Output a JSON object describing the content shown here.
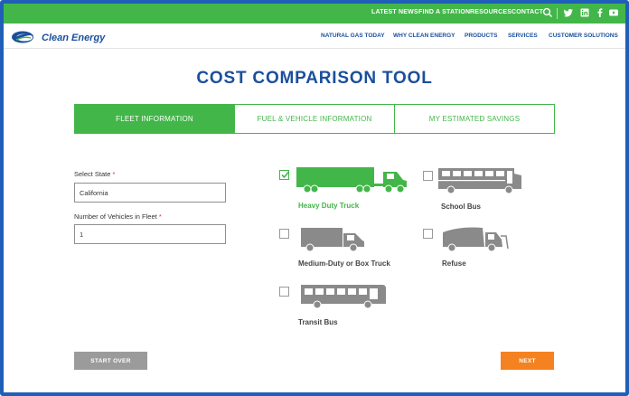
{
  "topbar": {
    "links": [
      "LATEST NEWS",
      "FIND A STATION",
      "RESOURCES",
      "CONTACT"
    ],
    "icons": [
      "search-icon",
      "twitter-icon",
      "linkedin-icon",
      "facebook-icon",
      "youtube-icon"
    ]
  },
  "header": {
    "logo_text": "Clean Energy",
    "nav": [
      "NATURAL GAS TODAY",
      "WHY CLEAN ENERGY",
      "PRODUCTS",
      "SERVICES",
      "CUSTOMER SOLUTIONS"
    ]
  },
  "page": {
    "title": "COST COMPARISON TOOL"
  },
  "tabs": [
    {
      "label": "FLEET INFORMATION",
      "active": true
    },
    {
      "label": "FUEL & VEHICLE INFORMATION",
      "active": false
    },
    {
      "label": "MY ESTIMATED SAVINGS",
      "active": false
    }
  ],
  "form": {
    "state_label": "Select State",
    "state_value": "California",
    "vehicles_label": "Number of Vehicles in Fleet",
    "vehicles_value": "1",
    "required_mark": "*"
  },
  "vehicles": [
    {
      "label": "Heavy Duty Truck",
      "checked": true,
      "icon": "semi-truck-icon"
    },
    {
      "label": "School Bus",
      "checked": false,
      "icon": "school-bus-icon"
    },
    {
      "label": "Medium-Duty or Box Truck",
      "checked": false,
      "icon": "box-truck-icon"
    },
    {
      "label": "Refuse",
      "checked": false,
      "icon": "refuse-truck-icon"
    },
    {
      "label": "Transit Bus",
      "checked": false,
      "icon": "transit-bus-icon"
    }
  ],
  "buttons": {
    "start_over": "START OVER",
    "next": "NEXT"
  },
  "colors": {
    "brand_green": "#43b649",
    "brand_blue": "#1b4f9c",
    "orange": "#f58220",
    "vehicle_gray": "#8a8a8a"
  }
}
